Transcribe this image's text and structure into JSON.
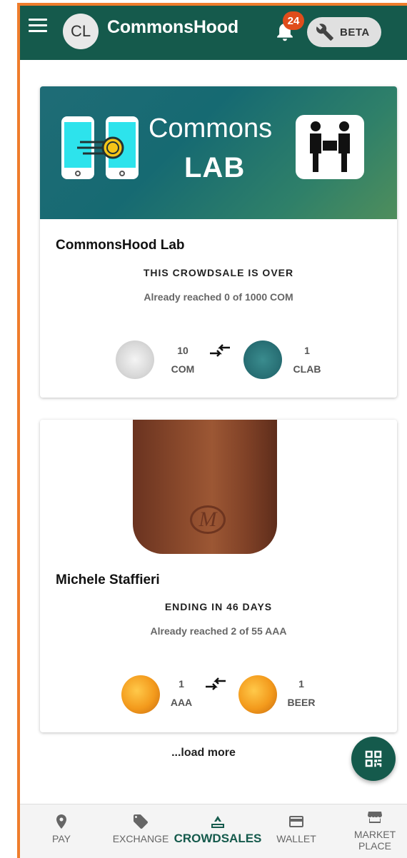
{
  "header": {
    "avatar_initials": "CL",
    "brand": "CommonsHood",
    "notification_count": "24",
    "beta_label": "BETA"
  },
  "crowdsales": [
    {
      "banner_title": "Commons",
      "banner_sub": "LAB",
      "title": "CommonsHood Lab",
      "status": "THIS CROWDSALE IS OVER",
      "progress": "Already reached 0 of 1000 COM",
      "give_amount": "10",
      "give_symbol": "COM",
      "get_amount": "1",
      "get_symbol": "CLAB"
    },
    {
      "title": "Michele Staffieri",
      "status": "ENDING IN 46 DAYS",
      "progress": "Already reached 2 of 55 AAA",
      "give_amount": "1",
      "give_symbol": "AAA",
      "get_amount": "1",
      "get_symbol": "BEER"
    }
  ],
  "load_more": "...load more",
  "nav": [
    {
      "label": "PAY",
      "icon": "location-pin-icon"
    },
    {
      "label": "EXCHANGE",
      "icon": "tag-icon"
    },
    {
      "label": "CROWDSALES",
      "icon": "crowdsale-icon",
      "active": true
    },
    {
      "label": "WALLET",
      "icon": "wallet-card-icon"
    },
    {
      "label": "MARKET PLACE",
      "icon": "store-icon"
    }
  ],
  "colors": {
    "primary": "#155a4c",
    "badge": "#e04d1c",
    "frame": "#ef7d2c"
  }
}
